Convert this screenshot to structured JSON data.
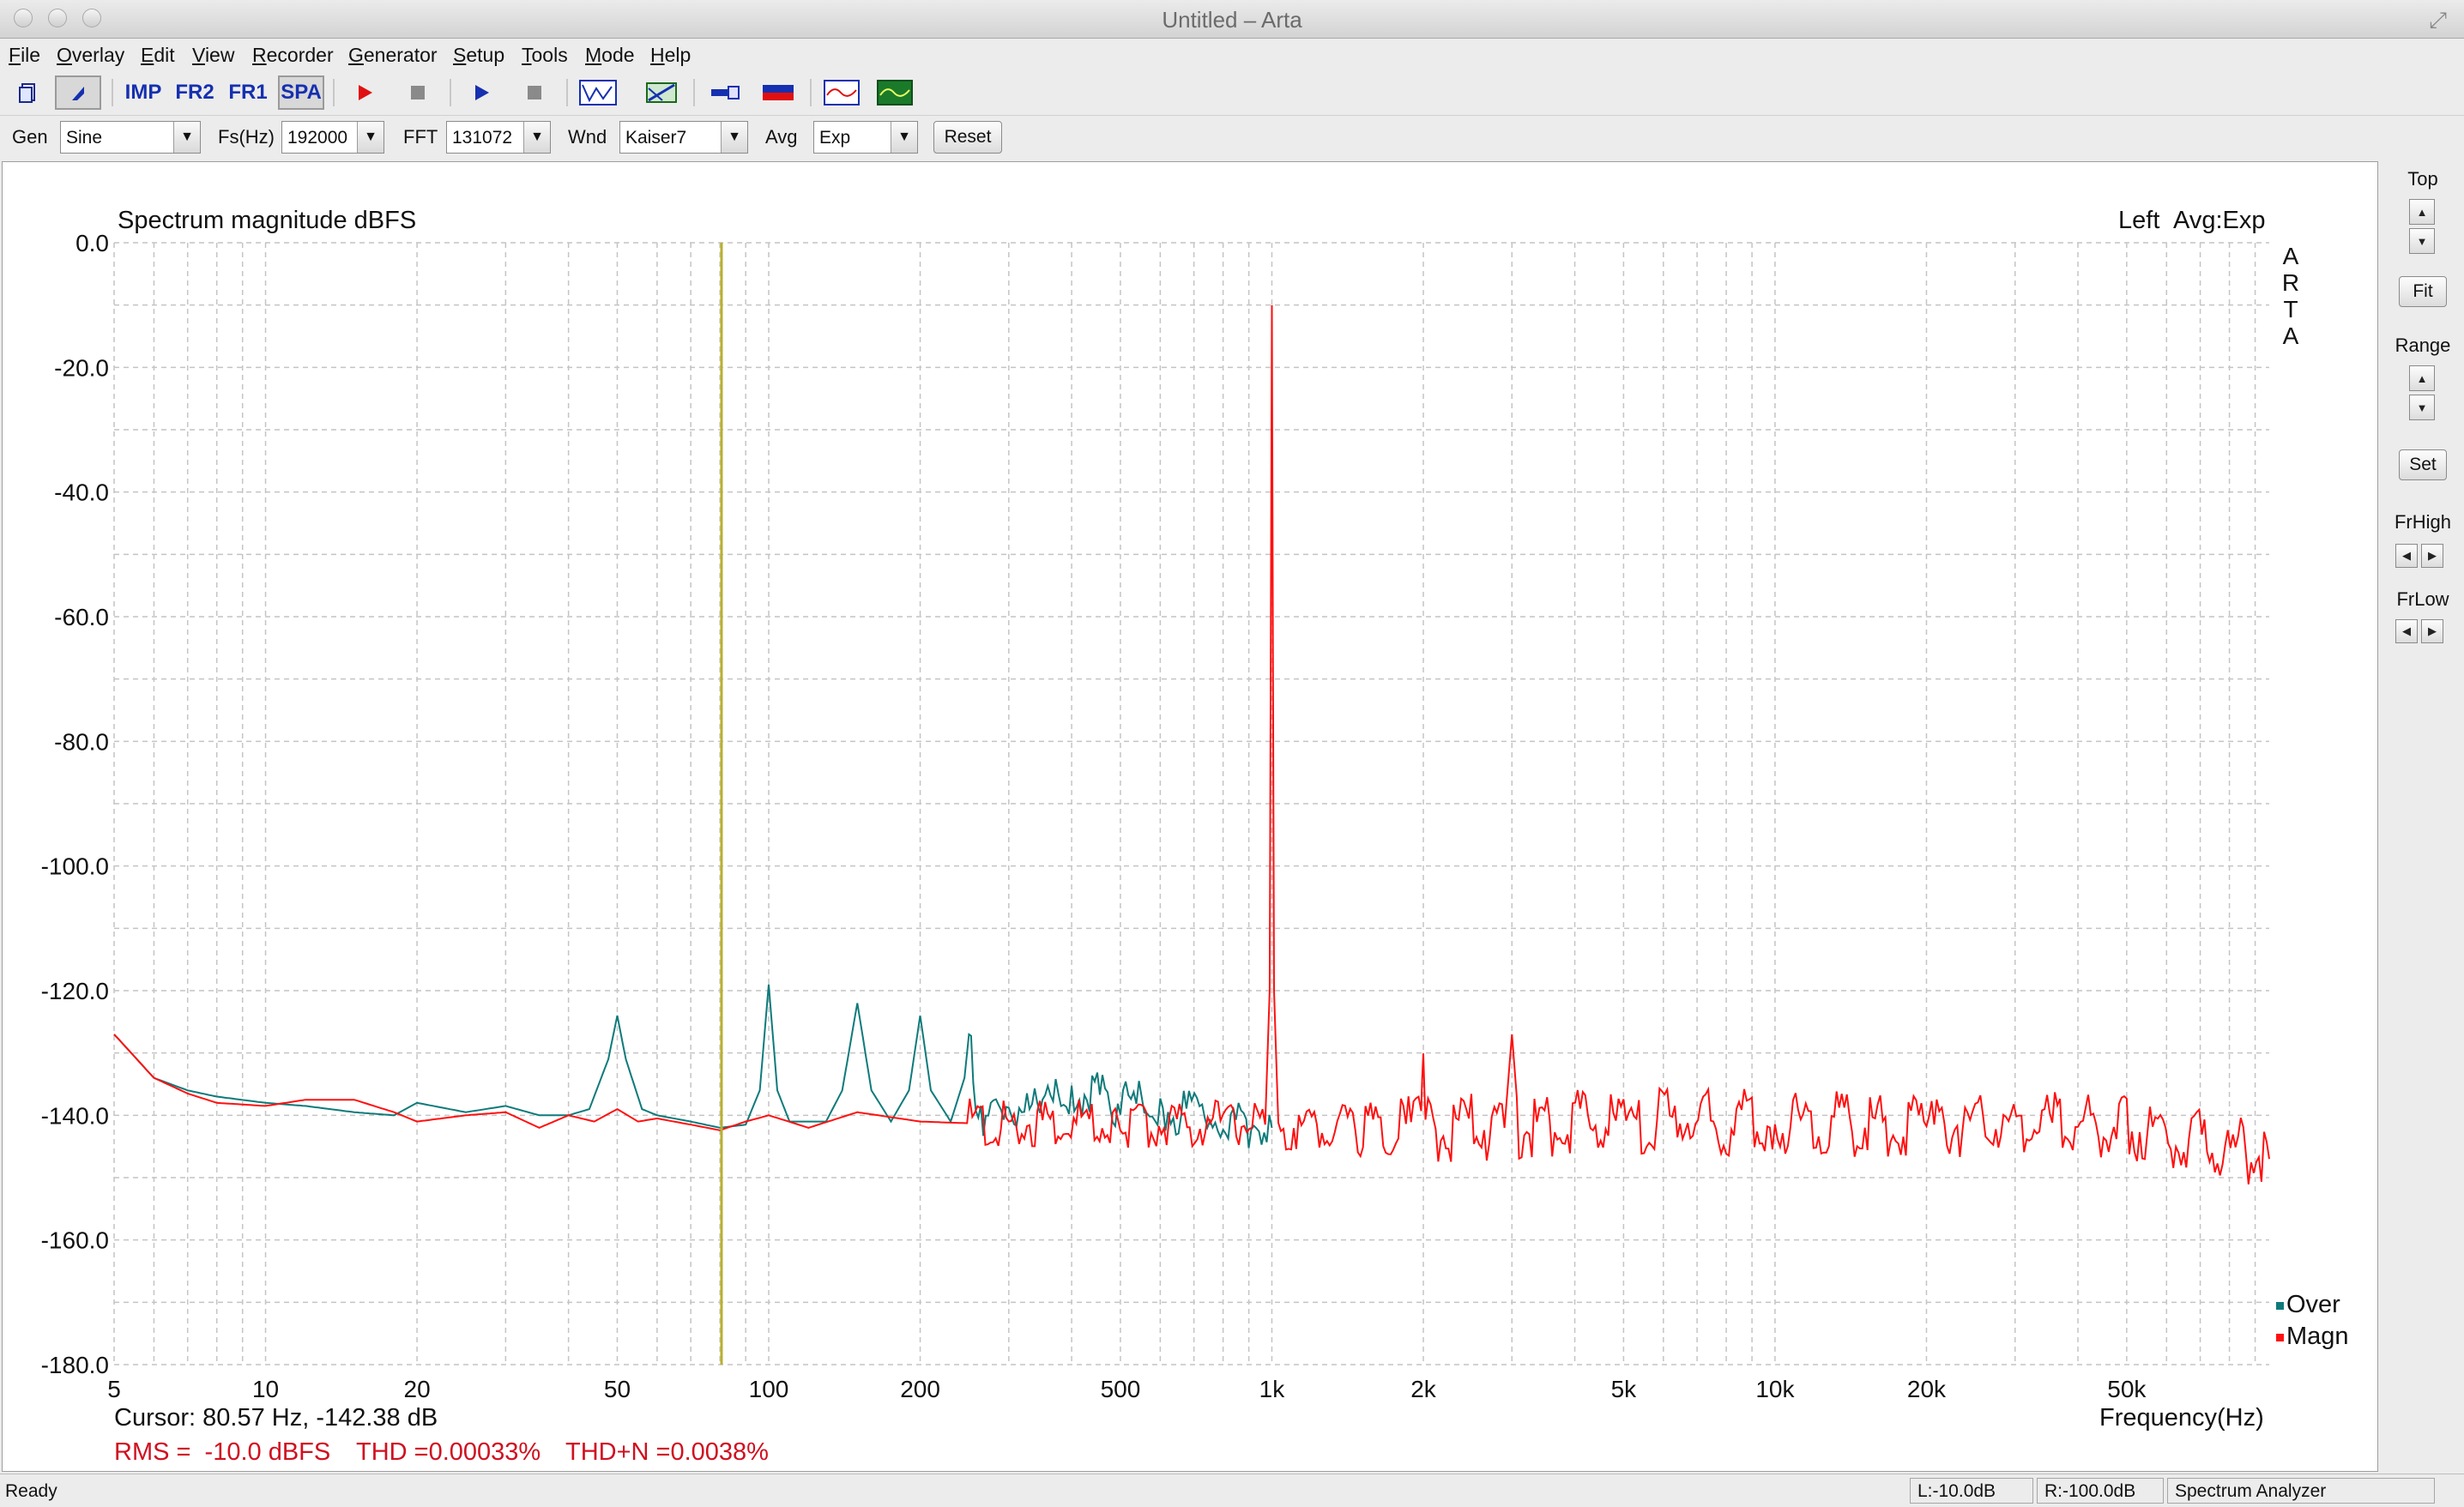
{
  "window": {
    "title": "Untitled – Arta"
  },
  "menu": [
    "File",
    "Overlay",
    "Edit",
    "View",
    "Recorder",
    "Generator",
    "Setup",
    "Tools",
    "Mode",
    "Help"
  ],
  "toolbar": {
    "imp_label": "IMP",
    "fr2_label": "FR2",
    "fr1_label": "FR1",
    "spa_label": "SPA"
  },
  "controls": {
    "gen_label": "Gen",
    "gen_value": "Sine",
    "fs_label": "Fs(Hz)",
    "fs_value": "192000",
    "fft_label": "FFT",
    "fft_value": "131072",
    "wnd_label": "Wnd",
    "wnd_value": "Kaiser7",
    "avg_label": "Avg",
    "avg_value": "Exp",
    "reset_label": "Reset"
  },
  "plot": {
    "title": "Spectrum magnitude dBFS",
    "channel": "Left",
    "avg_info": "Avg:Exp",
    "watermark": [
      "A",
      "R",
      "T",
      "A"
    ],
    "xlabel": "Frequency(Hz)",
    "cursor_text": "Cursor: 80.57 Hz, -142.38 dB",
    "rms_text": "RMS =  -10.0 dBFS",
    "thd_text": "THD =0.00033%",
    "thdn_text": "THD+N =0.0038%"
  },
  "right_panel": {
    "top_label": "Top",
    "fit_label": "Fit",
    "range_label": "Range",
    "set_label": "Set",
    "frhigh_label": "FrHigh",
    "frlow_label": "FrLow"
  },
  "status": {
    "ready": "Ready",
    "left_level": "L:-10.0dB",
    "right_level": "R:-100.0dB",
    "mode": "Spectrum Analyzer"
  },
  "colors": {
    "over": "#0f7a7a",
    "magn": "#ff1010",
    "cursor": "#b8b030",
    "grid": "#c4c4c4",
    "info_red": "#d01020"
  },
  "chart_data": {
    "type": "line",
    "title": "Spectrum magnitude dBFS",
    "xlabel": "Frequency(Hz)",
    "ylabel": "",
    "xscale": "log",
    "xlim": [
      5,
      96000
    ],
    "ylim": [
      -180,
      0
    ],
    "grid": true,
    "legend": "bottom-right",
    "y_ticks": [
      "0.0",
      "-20.0",
      "-40.0",
      "-60.0",
      "-80.0",
      "-100.0",
      "-120.0",
      "-140.0",
      "-160.0",
      "-180.0"
    ],
    "y_tick_values": [
      0,
      -20,
      -40,
      -60,
      -80,
      -100,
      -120,
      -140,
      -160,
      -180
    ],
    "x_ticks": [
      "5",
      "10",
      "20",
      "50",
      "100",
      "200",
      "500",
      "1k",
      "2k",
      "5k",
      "10k",
      "20k",
      "50k"
    ],
    "x_tick_values": [
      5,
      10,
      20,
      50,
      100,
      200,
      500,
      1000,
      2000,
      5000,
      10000,
      20000,
      50000
    ],
    "cursor_x": 80.57,
    "series": [
      {
        "name": "Over",
        "color": "#0f7a7a",
        "points": [
          [
            5,
            -127
          ],
          [
            6,
            -134
          ],
          [
            7,
            -136
          ],
          [
            8,
            -137
          ],
          [
            10,
            -138
          ],
          [
            12,
            -138.5
          ],
          [
            15,
            -139.5
          ],
          [
            18,
            -140
          ],
          [
            20,
            -138
          ],
          [
            25,
            -139.5
          ],
          [
            30,
            -138.5
          ],
          [
            35,
            -140
          ],
          [
            40,
            -140
          ],
          [
            44,
            -139
          ],
          [
            48,
            -131
          ],
          [
            50,
            -124
          ],
          [
            52,
            -131
          ],
          [
            56,
            -139
          ],
          [
            60,
            -140
          ],
          [
            70,
            -141
          ],
          [
            80,
            -142
          ],
          [
            90,
            -141.5
          ],
          [
            96,
            -136
          ],
          [
            100,
            -119
          ],
          [
            104,
            -136
          ],
          [
            110,
            -141
          ],
          [
            130,
            -141
          ],
          [
            140,
            -136
          ],
          [
            150,
            -122
          ],
          [
            160,
            -136
          ],
          [
            175,
            -141
          ],
          [
            190,
            -136
          ],
          [
            200,
            -124
          ],
          [
            210,
            -136
          ],
          [
            230,
            -141
          ],
          [
            245,
            -134
          ],
          [
            250,
            -127
          ],
          [
            255,
            -134
          ],
          [
            270,
            -141
          ],
          [
            300,
            -138
          ],
          [
            350,
            -140
          ],
          [
            400,
            -136
          ],
          [
            500,
            -138
          ],
          [
            600,
            -139
          ],
          [
            800,
            -141
          ],
          [
            1000,
            -142
          ]
        ]
      },
      {
        "name": "Magn",
        "color": "#ff1010",
        "points": [
          [
            5,
            -127
          ],
          [
            6,
            -134
          ],
          [
            7,
            -136.5
          ],
          [
            8,
            -138
          ],
          [
            10,
            -138.5
          ],
          [
            12,
            -137.5
          ],
          [
            15,
            -137.5
          ],
          [
            18,
            -139.5
          ],
          [
            20,
            -141
          ],
          [
            25,
            -140
          ],
          [
            30,
            -139.5
          ],
          [
            35,
            -142
          ],
          [
            40,
            -140
          ],
          [
            45,
            -141
          ],
          [
            50,
            -139
          ],
          [
            55,
            -141
          ],
          [
            60,
            -140.5
          ],
          [
            70,
            -141.5
          ],
          [
            80,
            -142.4
          ],
          [
            90,
            -141
          ],
          [
            100,
            -140
          ],
          [
            120,
            -142
          ],
          [
            150,
            -139.5
          ],
          [
            200,
            -141
          ],
          [
            300,
            -141.5
          ],
          [
            500,
            -141.5
          ],
          [
            800,
            -141.5
          ],
          [
            970,
            -141.5
          ],
          [
            990,
            -120
          ],
          [
            1000,
            -10
          ],
          [
            1010,
            -120
          ],
          [
            1030,
            -141.5
          ],
          [
            1500,
            -142
          ],
          [
            1980,
            -142
          ],
          [
            2000,
            -130
          ],
          [
            2020,
            -142
          ],
          [
            2900,
            -142
          ],
          [
            3000,
            -127
          ],
          [
            3100,
            -142
          ],
          [
            5000,
            -141
          ],
          [
            10000,
            -141
          ],
          [
            20000,
            -141.5
          ],
          [
            50000,
            -141.5
          ],
          [
            96000,
            -147
          ]
        ]
      }
    ]
  }
}
